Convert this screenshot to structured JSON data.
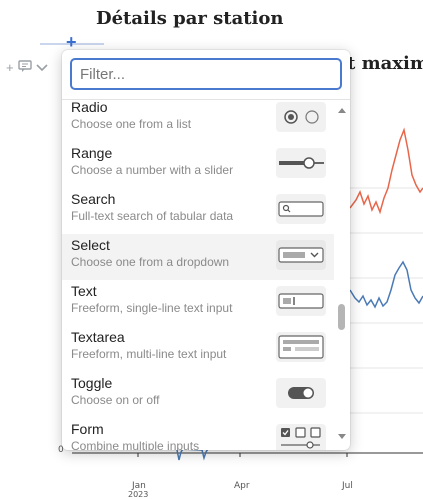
{
  "page": {
    "title": "Détails par station",
    "chart_title": "t maxim",
    "add_icon": "plus-icon",
    "left_icons": [
      "plus-icon",
      "comment-icon",
      "chevron-down-icon"
    ]
  },
  "chart": {
    "x_ticks": [
      "Jan",
      "Apr",
      "Jul"
    ],
    "x_tick_sub": "2023",
    "y_zero": "0",
    "colors": {
      "series_1": "#e8664a",
      "series_2": "#4a7ab5"
    }
  },
  "popup": {
    "filter_placeholder": "Filter...",
    "items": [
      {
        "label": "Radio",
        "desc": "Choose one from a list",
        "icon": "radio-icon"
      },
      {
        "label": "Range",
        "desc": "Choose a number with a slider",
        "icon": "slider-icon"
      },
      {
        "label": "Search",
        "desc": "Full-text search of tabular data",
        "icon": "search-field-icon"
      },
      {
        "label": "Select",
        "desc": "Choose one from a dropdown",
        "icon": "dropdown-icon"
      },
      {
        "label": "Text",
        "desc": "Freeform, single-line text input",
        "icon": "text-input-icon"
      },
      {
        "label": "Textarea",
        "desc": "Freeform, multi-line text input",
        "icon": "textarea-icon"
      },
      {
        "label": "Toggle",
        "desc": "Choose on or off",
        "icon": "toggle-icon"
      },
      {
        "label": "Form",
        "desc": "Combine multiple inputs",
        "icon": "form-icon"
      }
    ]
  }
}
